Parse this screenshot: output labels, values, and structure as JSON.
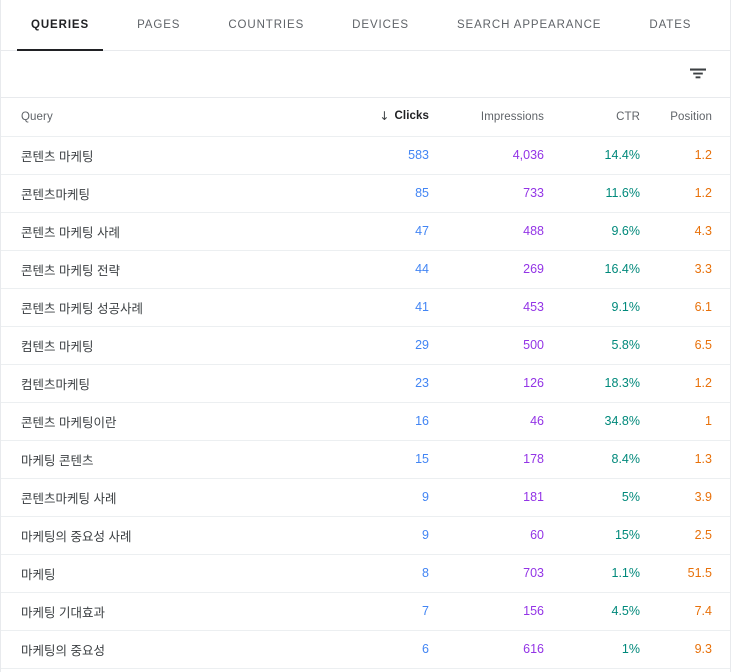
{
  "tabs": [
    {
      "label": "QUERIES",
      "active": true
    },
    {
      "label": "PAGES",
      "active": false
    },
    {
      "label": "COUNTRIES",
      "active": false
    },
    {
      "label": "DEVICES",
      "active": false
    },
    {
      "label": "SEARCH APPEARANCE",
      "active": false
    },
    {
      "label": "DATES",
      "active": false
    }
  ],
  "toolbar": {
    "filter_icon": "filter-icon"
  },
  "table": {
    "columns": {
      "query": "Query",
      "clicks": "Clicks",
      "impressions": "Impressions",
      "ctr": "CTR",
      "position": "Position"
    },
    "sort": {
      "column": "Clicks",
      "direction": "descending",
      "arrow": "↓"
    },
    "colors": {
      "clicks": "#4285f4",
      "impressions": "#9334e6",
      "ctr": "#00897b",
      "position": "#e8710a"
    },
    "rows": [
      {
        "query": "콘텐츠 마케팅",
        "clicks": "583",
        "impressions": "4,036",
        "ctr": "14.4%",
        "position": "1.2"
      },
      {
        "query": "콘텐츠마케팅",
        "clicks": "85",
        "impressions": "733",
        "ctr": "11.6%",
        "position": "1.2"
      },
      {
        "query": "콘텐츠 마케팅 사례",
        "clicks": "47",
        "impressions": "488",
        "ctr": "9.6%",
        "position": "4.3"
      },
      {
        "query": "콘텐츠 마케팅 전략",
        "clicks": "44",
        "impressions": "269",
        "ctr": "16.4%",
        "position": "3.3"
      },
      {
        "query": "콘텐츠 마케팅 성공사례",
        "clicks": "41",
        "impressions": "453",
        "ctr": "9.1%",
        "position": "6.1"
      },
      {
        "query": "컴텐츠 마케팅",
        "clicks": "29",
        "impressions": "500",
        "ctr": "5.8%",
        "position": "6.5"
      },
      {
        "query": "컴텐츠마케팅",
        "clicks": "23",
        "impressions": "126",
        "ctr": "18.3%",
        "position": "1.2"
      },
      {
        "query": "콘텐츠 마케팅이란",
        "clicks": "16",
        "impressions": "46",
        "ctr": "34.8%",
        "position": "1"
      },
      {
        "query": "마케팅 콘텐츠",
        "clicks": "15",
        "impressions": "178",
        "ctr": "8.4%",
        "position": "1.3"
      },
      {
        "query": "콘텐츠마케팅 사례",
        "clicks": "9",
        "impressions": "181",
        "ctr": "5%",
        "position": "3.9"
      },
      {
        "query": "마케팅의 중요성 사례",
        "clicks": "9",
        "impressions": "60",
        "ctr": "15%",
        "position": "2.5"
      },
      {
        "query": "마케팅",
        "clicks": "8",
        "impressions": "703",
        "ctr": "1.1%",
        "position": "51.5"
      },
      {
        "query": "마케팅 기대효과",
        "clicks": "7",
        "impressions": "156",
        "ctr": "4.5%",
        "position": "7.4"
      },
      {
        "query": "마케팅의 중요성",
        "clicks": "6",
        "impressions": "616",
        "ctr": "1%",
        "position": "9.3"
      }
    ]
  }
}
